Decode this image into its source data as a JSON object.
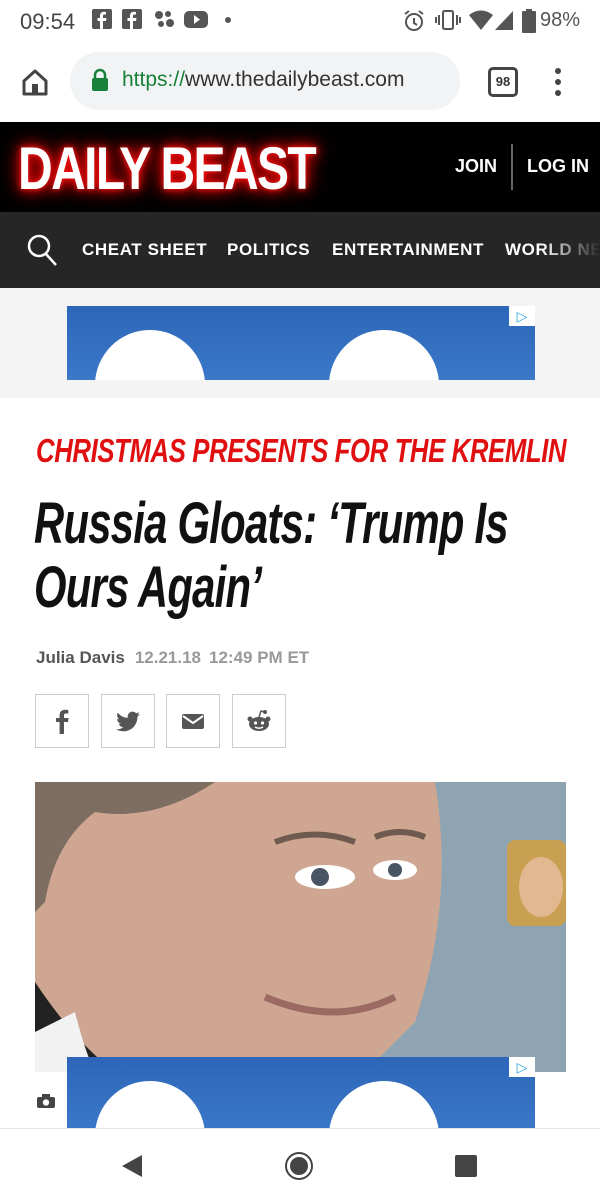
{
  "status": {
    "time": "09:54",
    "battery": "98%",
    "notification_icons": [
      "facebook-icon",
      "facebook-icon",
      "pinwheel-icon",
      "youtube-icon",
      "dot-icon"
    ],
    "system_icons": [
      "alarm-icon",
      "vibrate-icon",
      "wifi-icon",
      "signal-icon",
      "battery-icon"
    ]
  },
  "browser": {
    "url_protocol": "https://",
    "url_host": "www.thedailybeast.com",
    "tab_count": "98"
  },
  "site": {
    "logo": "DAILY BEAST",
    "join": "JOIN",
    "login": "LOG IN",
    "nav": [
      "CHEAT SHEET",
      "POLITICS",
      "ENTERTAINMENT",
      "WORLD NEWS"
    ]
  },
  "article": {
    "kicker": "CHRISTMAS PRESENTS FOR THE KREMLIN",
    "headline": "Russia Gloats: ‘Trump Is Ours Again’",
    "author": "Julia Davis",
    "date": "12.21.18",
    "time": "12:49 PM ET"
  },
  "colors": {
    "brand_red": "#e01010",
    "header_bg": "#000000",
    "nav_bg": "#262626",
    "ad_blue": "#3b78c8"
  }
}
